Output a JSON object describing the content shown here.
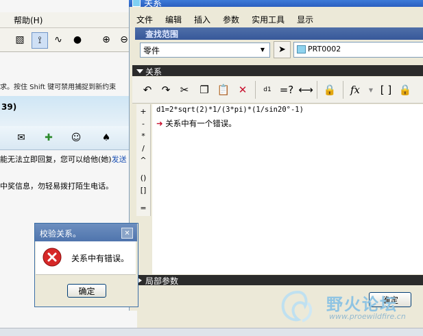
{
  "background_app": {
    "menu_help": "帮助(H)",
    "status_hint": "求。按住 Shift 键可禁用捕捉到新约束",
    "number_label": "39)",
    "message_line": {
      "text": "能无法立即回复，您可以给他(她)",
      "link": "发送"
    },
    "warning_line": "中奖信息，勿轻易拨打陌生电话。"
  },
  "relations_dialog": {
    "title": "关系",
    "menu": [
      "文件",
      "编辑",
      "插入",
      "参数",
      "实用工具",
      "显示"
    ],
    "search_scope": {
      "label": "查找范围",
      "type_value": "零件",
      "model_value": "PRT0002"
    },
    "relations_section": {
      "label": "关系",
      "operators": [
        "+",
        "-",
        "*",
        "/",
        "^",
        "()",
        "[]",
        "="
      ],
      "equation": "d1=2*sqrt(2)*1/(3*pi)*(1/sin20°-1)",
      "error": "关系中有一个错误。"
    },
    "local_params_label": "局部参数",
    "ok_label": "确定"
  },
  "check_dialog": {
    "title": "校验关系。",
    "message": "关系中有错误。",
    "ok_label": "确定"
  },
  "watermark": {
    "text": "野火论坛",
    "url": "www.proewildfire.cn"
  },
  "colors": {
    "xp_title_blue": "#2a5fc0",
    "section_dark": "#2b2b2b",
    "error_red": "#c8102e"
  }
}
